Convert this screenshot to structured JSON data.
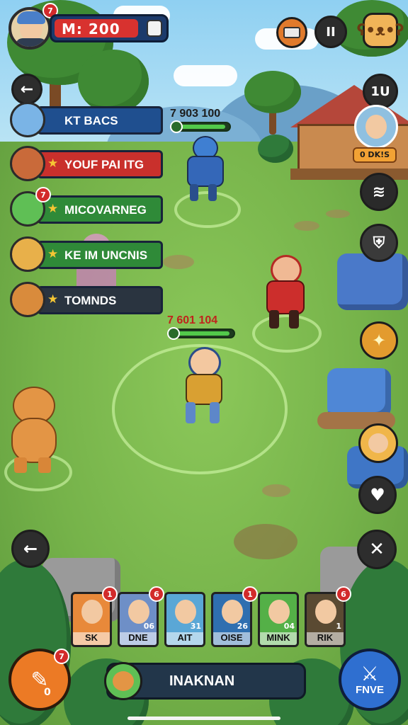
{
  "player": {
    "currency_label": "M: 200",
    "notification_count": "7"
  },
  "top_buttons": {
    "pause": "II",
    "level": "1U"
  },
  "npc": {
    "label": "0 DK!S"
  },
  "roster": [
    {
      "name": "KT BACS",
      "starred": false,
      "badge": "",
      "bar_color": "#1f4f8f"
    },
    {
      "name": "YOUF PAI ITG",
      "starred": true,
      "badge": "",
      "bar_color": "#c9302c"
    },
    {
      "name": "MICOVARNEG",
      "starred": true,
      "badge": "7",
      "bar_color": "#2f8a38"
    },
    {
      "name": "KE IM UNCNIS",
      "starred": true,
      "badge": "",
      "bar_color": "#2f8a38"
    },
    {
      "name": "TOMNDS",
      "starred": true,
      "badge": "",
      "bar_color": "#2a3440"
    }
  ],
  "enemy_hp": {
    "text": "7 903 100",
    "fraction": 0.95
  },
  "player_hp": {
    "text": "7 601 104",
    "fraction": 0.95
  },
  "cards": [
    {
      "label": "SK",
      "count": "",
      "badge": "1",
      "color": "#e8893a"
    },
    {
      "label": "DNE",
      "count": "06",
      "badge": "6",
      "color": "#6e8fc7"
    },
    {
      "label": "AIT",
      "count": "31",
      "badge": "",
      "color": "#5aa7d6"
    },
    {
      "label": "OISE",
      "count": "26",
      "badge": "1",
      "color": "#2f6fb0"
    },
    {
      "label": "MINK",
      "count": "04",
      "badge": "",
      "color": "#54b047"
    },
    {
      "label": "RIK",
      "count": "1",
      "badge": "6",
      "color": "#5a4a32"
    }
  ],
  "bottom_bar": {
    "label": "INAKNAN"
  },
  "left_action": {
    "count": "0",
    "badge": "7"
  },
  "right_action": {
    "label": "FNVE"
  }
}
